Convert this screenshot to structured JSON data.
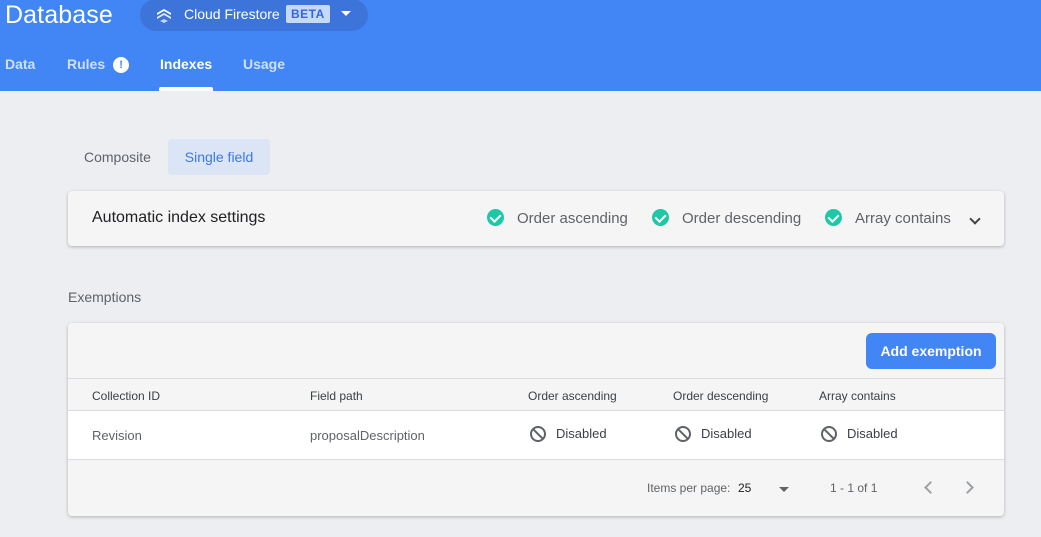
{
  "header": {
    "title": "Database",
    "db_selector": {
      "name": "Cloud Firestore",
      "badge": "BETA",
      "icon": "firestore-icon"
    },
    "tabs": [
      {
        "label": "Data"
      },
      {
        "label": "Rules",
        "badge": "!"
      },
      {
        "label": "Indexes",
        "active": true
      },
      {
        "label": "Usage"
      }
    ]
  },
  "index_type": {
    "options": [
      "Composite",
      "Single field"
    ],
    "selected": "Single field"
  },
  "automatic_settings": {
    "label": "Automatic index settings",
    "options": [
      {
        "label": "Order ascending",
        "enabled": true
      },
      {
        "label": "Order descending",
        "enabled": true
      },
      {
        "label": "Array contains",
        "enabled": true
      }
    ]
  },
  "exemptions": {
    "section_title": "Exemptions",
    "add_button": "Add exemption",
    "columns": [
      "Collection ID",
      "Field path",
      "Order ascending",
      "Order descending",
      "Array contains"
    ],
    "rows": [
      {
        "collection_id": "Revision",
        "field_path": "proposalDescription",
        "order_ascending": "Disabled",
        "order_descending": "Disabled",
        "array_contains": "Disabled"
      }
    ],
    "pagination": {
      "items_per_page_label": "Items per page:",
      "items_per_page": "25",
      "range": "1 - 1 of 1"
    }
  },
  "colors": {
    "header_bg": "#4285f4",
    "check_green": "#1ec8a5",
    "button_blue": "#4285f4"
  }
}
